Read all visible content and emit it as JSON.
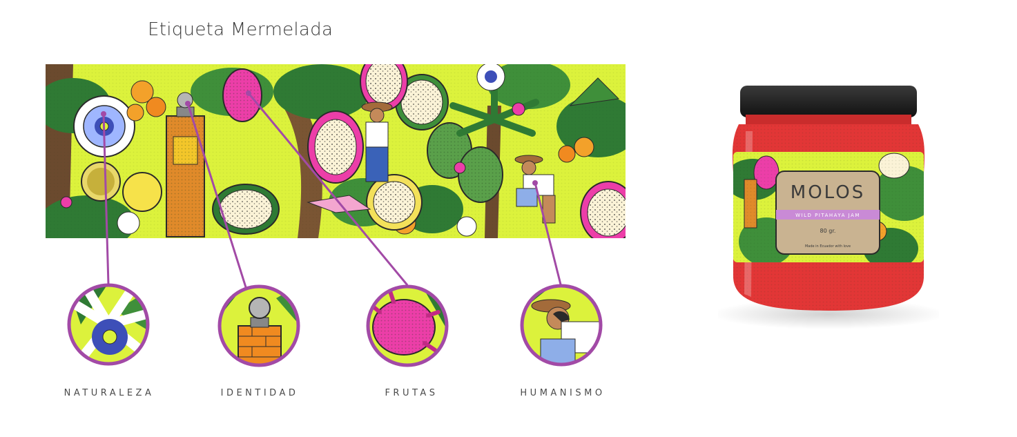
{
  "title": "Etiqueta Mermelada",
  "colors": {
    "accent_purple": "#a24aa6",
    "banner_bg": "#dcf23c",
    "leaf_green": "#2f7a34",
    "fruit_pink": "#ec3ea8",
    "brick_orange": "#e08a2a",
    "jam_red": "#e23636",
    "lid_black": "#1f1f1f"
  },
  "medallions": [
    {
      "label": "NATURALEZA",
      "icon": "passion-flower-icon"
    },
    {
      "label": "IDENTIDAD",
      "icon": "monument-icon"
    },
    {
      "label": "FRUTAS",
      "icon": "pitahaya-fruit-icon"
    },
    {
      "label": "HUMANISMO",
      "icon": "farmer-icon"
    }
  ],
  "jar_label": {
    "brand": "MOLOS",
    "product": "WILD PITAHAYA JAM",
    "weight": "80 gr.",
    "tagline": "Made in Ecuador with love"
  }
}
